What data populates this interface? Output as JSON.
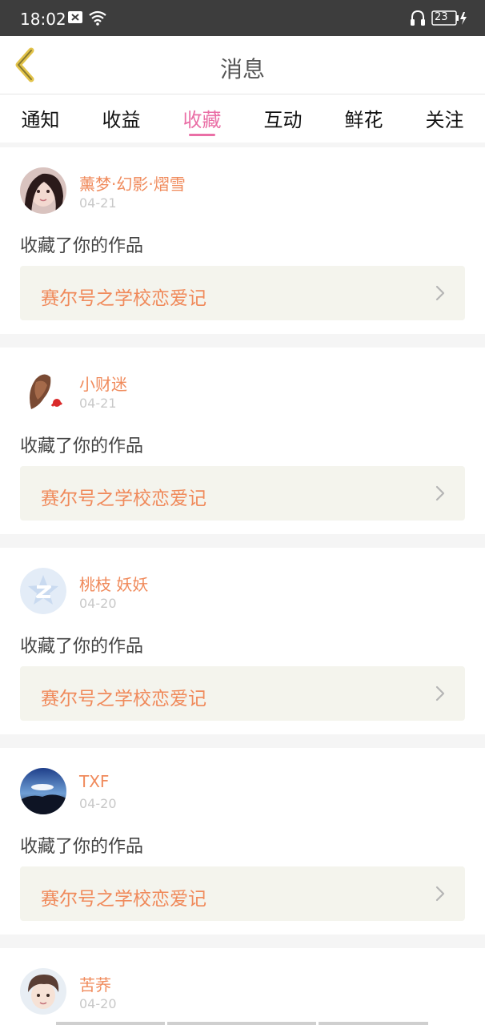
{
  "status_bar": {
    "time": "18:02",
    "battery_level": "23",
    "icons": [
      "notification-x-icon",
      "wifi-icon",
      "headset-icon",
      "battery-icon",
      "charging-icon"
    ]
  },
  "header": {
    "title": "消息",
    "back_icon": "chevron-left-icon"
  },
  "tabs": [
    {
      "label": "通知",
      "active": false
    },
    {
      "label": "收益",
      "active": false
    },
    {
      "label": "收藏",
      "active": true
    },
    {
      "label": "互动",
      "active": false
    },
    {
      "label": "鲜花",
      "active": false
    },
    {
      "label": "关注",
      "active": false
    }
  ],
  "messages": [
    {
      "user": "薰梦·幻影·熠雪",
      "date": "04-21",
      "action": "收藏了你的作品",
      "work_title": "赛尔号之学校恋爱记"
    },
    {
      "user": "小财迷",
      "date": "04-21",
      "action": "收藏了你的作品",
      "work_title": "赛尔号之学校恋爱记"
    },
    {
      "user": "桃枝 妖妖",
      "date": "04-20",
      "action": "收藏了你的作品",
      "work_title": "赛尔号之学校恋爱记"
    },
    {
      "user": "TXF",
      "date": "04-20",
      "action": "收藏了你的作品",
      "work_title": "赛尔号之学校恋爱记"
    },
    {
      "user": "苦荞",
      "date": "04-20"
    }
  ],
  "colors": {
    "accent_pink": "#ea6fa6",
    "orange_text": "#f08a5b",
    "status_bar_bg": "#3d3d3d",
    "card_box_bg": "#f4f4ed",
    "back_icon_color": "#e2c34a"
  }
}
